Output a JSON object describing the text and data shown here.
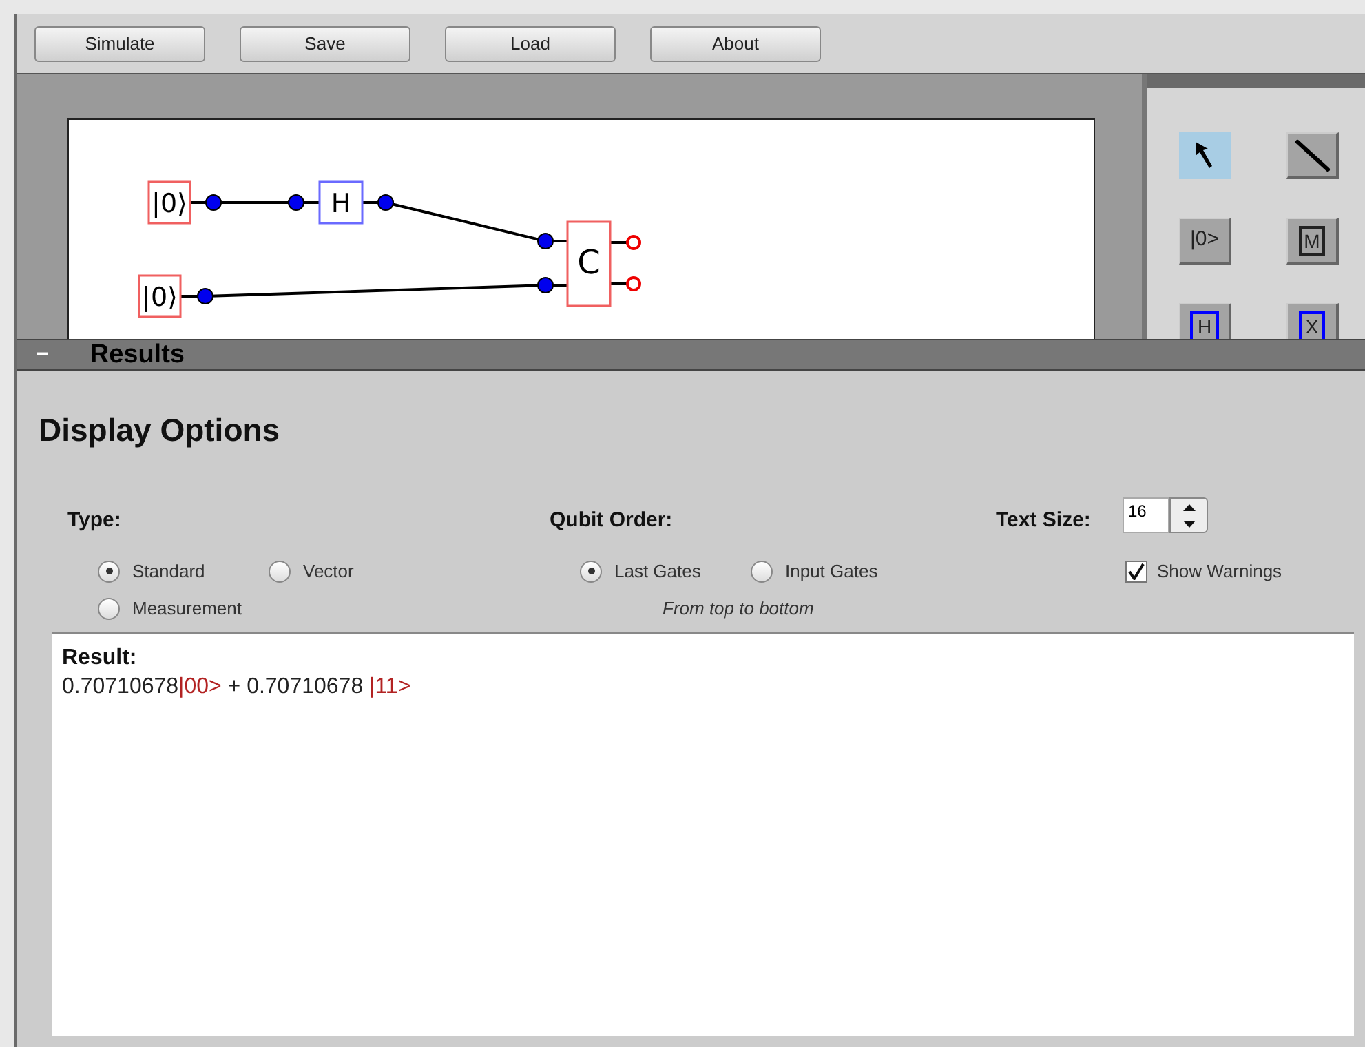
{
  "toolbar": {
    "buttons": [
      "Simulate",
      "Save",
      "Load",
      "About"
    ]
  },
  "circuit": {
    "gates": [
      {
        "kind": "input",
        "label": "|0⟩"
      },
      {
        "kind": "gate",
        "label": "H"
      },
      {
        "kind": "input",
        "label": "|0⟩"
      },
      {
        "kind": "measure",
        "label": "C"
      }
    ]
  },
  "palette": [
    {
      "kind": "select",
      "selected": true
    },
    {
      "kind": "wire",
      "selected": false
    },
    {
      "kind": "input",
      "label": "|0>",
      "selected": false
    },
    {
      "kind": "measure",
      "label": "M",
      "selected": false
    },
    {
      "kind": "gate",
      "label": "H",
      "selected": false
    },
    {
      "kind": "gate",
      "label": "X",
      "selected": false
    }
  ],
  "results_panel": {
    "title": "Results",
    "collapse_symbol": "−"
  },
  "display_options": {
    "title": "Display Options",
    "type": {
      "label": "Type:",
      "options": [
        {
          "label": "Standard",
          "selected": true
        },
        {
          "label": "Vector",
          "selected": false
        },
        {
          "label": "Measurement",
          "selected": false
        }
      ]
    },
    "qubit_order": {
      "label": "Qubit Order:",
      "options": [
        {
          "label": "Last Gates",
          "selected": true
        },
        {
          "label": "Input Gates",
          "selected": false
        }
      ],
      "note": "From top to bottom"
    },
    "text_size": {
      "label": "Text Size:",
      "value": "16"
    },
    "show_warnings": {
      "label": "Show Warnings",
      "checked": true
    }
  },
  "result": {
    "label": "Result:",
    "segments": [
      {
        "kind": "amplitude",
        "text": "0.70710678"
      },
      {
        "kind": "ket",
        "text": "|00>"
      },
      {
        "kind": "amplitude",
        "text": " + 0.70710678 "
      },
      {
        "kind": "ket",
        "text": "|11>"
      }
    ]
  }
}
